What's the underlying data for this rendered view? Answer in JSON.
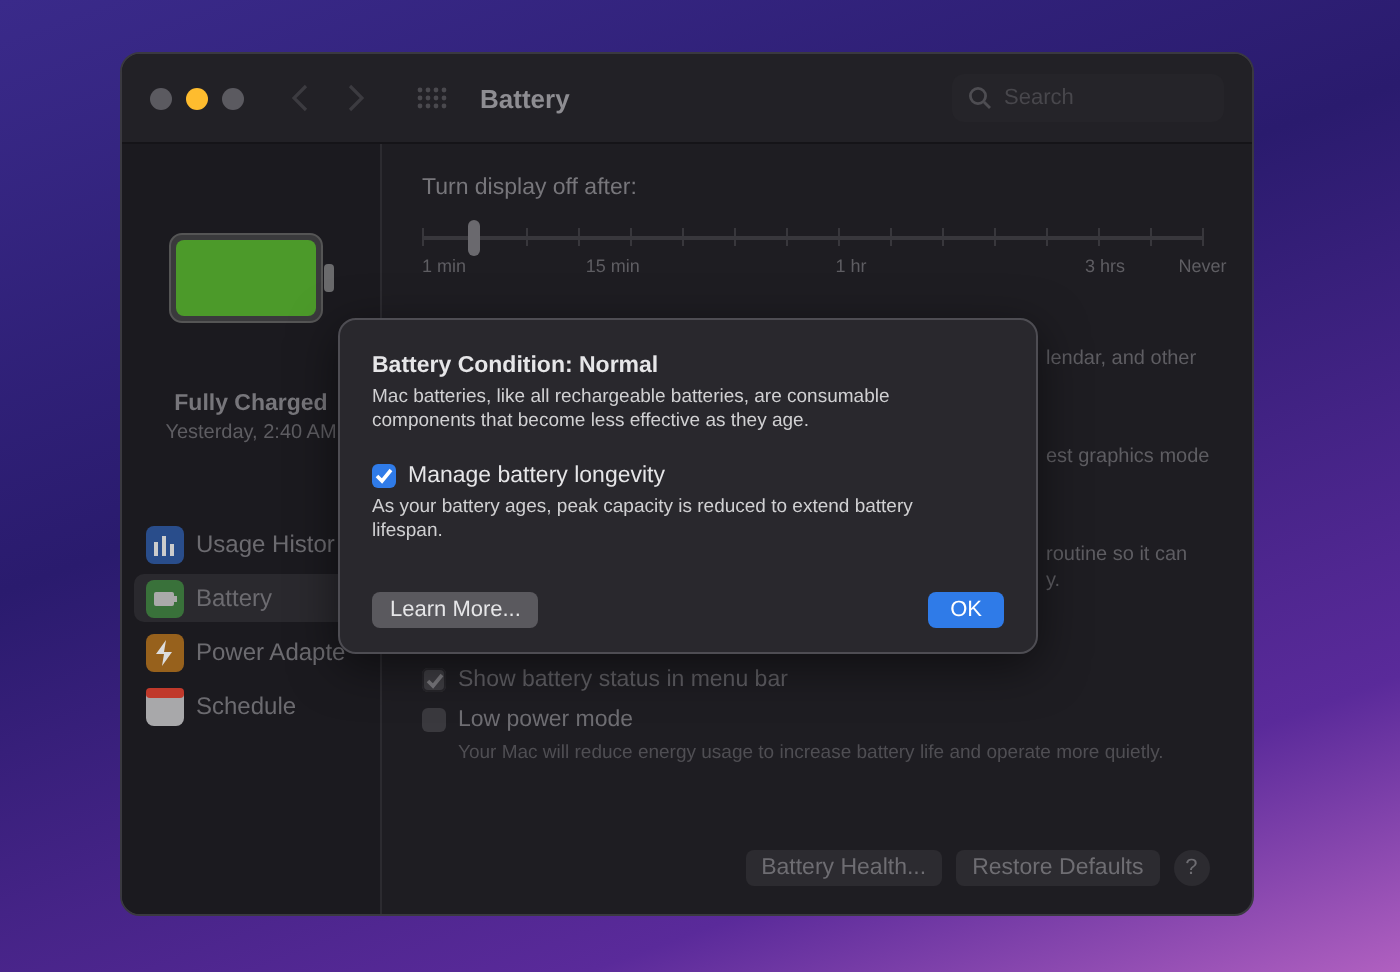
{
  "window": {
    "title": "Battery",
    "search": {
      "placeholder": "Search"
    },
    "traffic_lights": [
      {
        "color": "#5b5a60"
      },
      {
        "color": "#febc2e"
      },
      {
        "color": "#5b5a60"
      }
    ]
  },
  "sidebar": {
    "status": {
      "title": "Fully Charged",
      "subtitle": "Yesterday, 2:40 AM",
      "level": 1.0
    },
    "items": [
      {
        "label": "Usage Histor",
        "kind": "usage",
        "selected": false
      },
      {
        "label": "Battery",
        "kind": "battery",
        "selected": true
      },
      {
        "label": "Power Adapte",
        "kind": "power",
        "selected": false
      },
      {
        "label": "Schedule",
        "kind": "schedule",
        "selected": false
      }
    ]
  },
  "display_off": {
    "label": "Turn display off after:",
    "level": 0.067,
    "ticks": [
      "1 min",
      "15 min",
      "1 hr",
      "3 hrs",
      "Never"
    ]
  },
  "covered_fragments": [
    "lendar, and other",
    "est graphics mode",
    "routine so it can",
    "y."
  ],
  "options": [
    {
      "label": "Show battery status in menu bar",
      "checked": true,
      "disabled": true
    },
    {
      "label": "Low power mode",
      "checked": false,
      "disabled": false,
      "description": "Your Mac will reduce energy usage to increase battery life and operate more quietly."
    }
  ],
  "footer_buttons": [
    "Battery Health...",
    "Restore Defaults"
  ],
  "help": "?",
  "dialog": {
    "title": "Battery Condition: Normal",
    "body": "Mac batteries, like all rechargeable batteries, are consumable components that become less effective as they age.",
    "checkbox": {
      "label": "Manage battery longevity",
      "checked": true,
      "description": "As your battery ages, peak capacity is reduced to extend battery lifespan."
    },
    "buttons": [
      {
        "label": "Learn More...",
        "kind": "secondary"
      },
      {
        "label": "OK",
        "kind": "default"
      }
    ]
  }
}
